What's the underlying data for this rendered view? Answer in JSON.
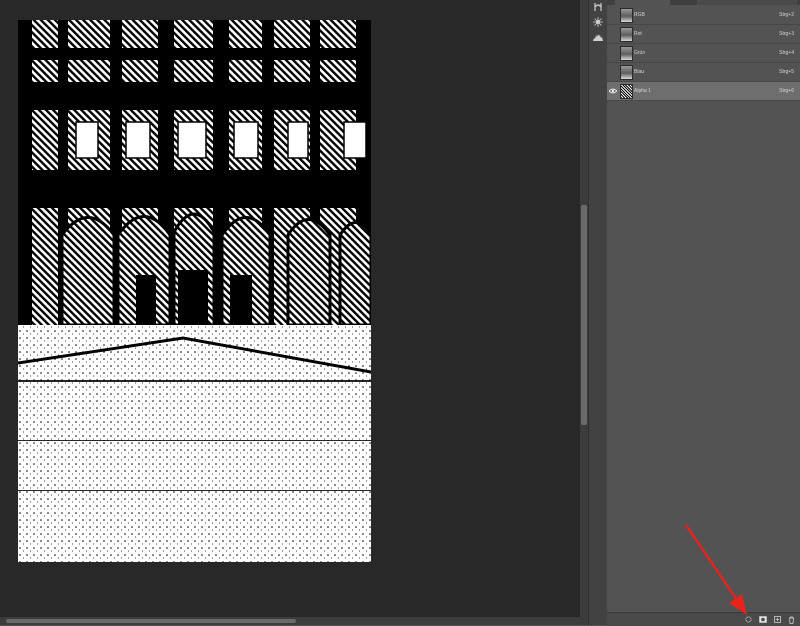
{
  "channels_panel": {
    "channels": [
      {
        "name": "RGB",
        "shortcut": "Strg+2",
        "visible": false,
        "selected": false
      },
      {
        "name": "Rot",
        "shortcut": "Strg+3",
        "visible": false,
        "selected": false
      },
      {
        "name": "Grün",
        "shortcut": "Strg+4",
        "visible": false,
        "selected": false
      },
      {
        "name": "Blau",
        "shortcut": "Strg+5",
        "visible": false,
        "selected": false
      },
      {
        "name": "Alpha 1",
        "shortcut": "Strg+6",
        "visible": true,
        "selected": true
      }
    ],
    "bottom_buttons": [
      "load-channel-as-selection-icon",
      "save-selection-as-channel-icon",
      "new-channel-icon",
      "delete-channel-icon"
    ]
  },
  "dock_icons": [
    "adjustments-icon",
    "brush-settings-icon",
    "histogram-icon"
  ],
  "annotation": {
    "color": "#e8231c",
    "points_to": "save-selection-as-channel-icon"
  },
  "colors": {
    "app_background": "#535353",
    "document_background": "#282828",
    "selected_row": "#6e6e6e"
  }
}
